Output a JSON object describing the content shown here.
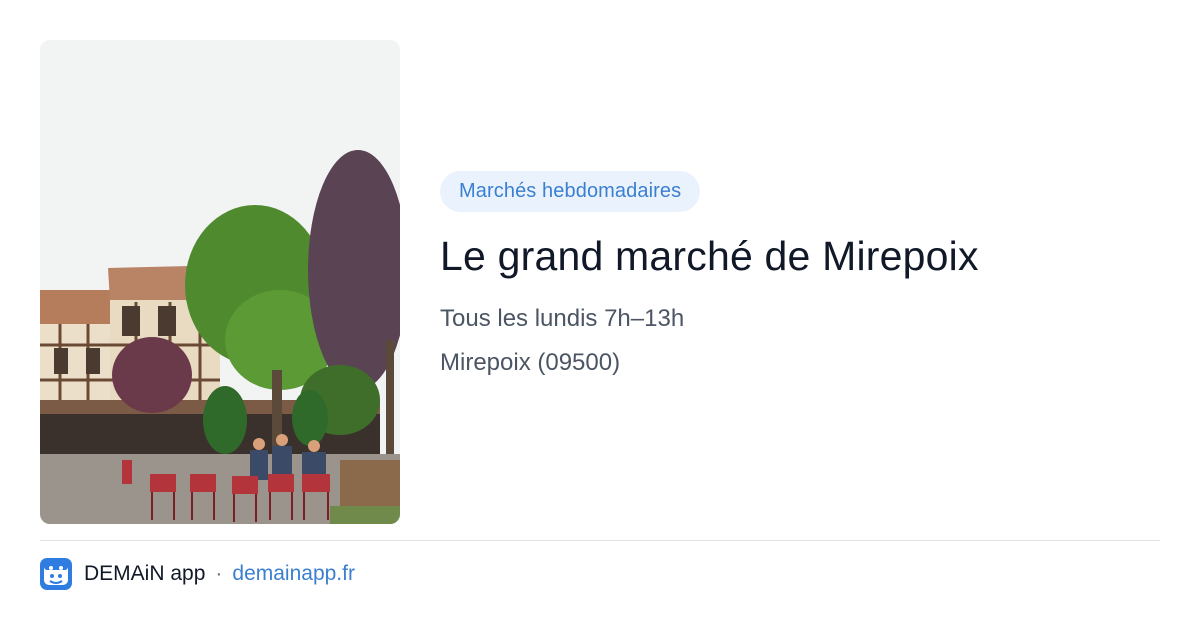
{
  "card": {
    "category": "Marchés hebdomadaires",
    "title": "Le grand marché de Mirepoix",
    "schedule": "Tous les lundis 7h–13h",
    "location": "Mirepoix (09500)",
    "photo_subject": "market-square-photo"
  },
  "footer": {
    "app_name": "DEMAiN app",
    "separator": "·",
    "domain": "demainapp.fr",
    "icon": "demain-app-logo-icon"
  },
  "colors": {
    "accent": "#3b7fd0",
    "badge_bg": "#eaf3fd",
    "title": "#111827",
    "muted": "#4b5563",
    "divider": "#dfe3e8"
  }
}
